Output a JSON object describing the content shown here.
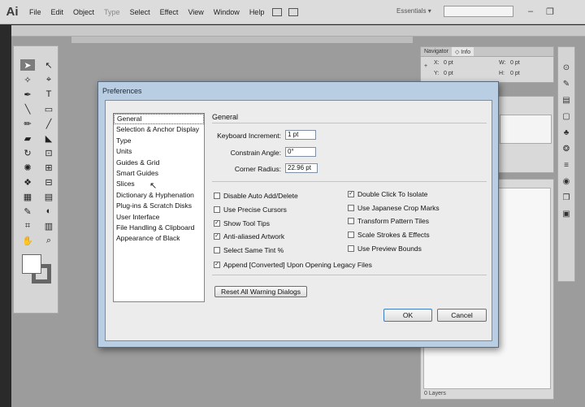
{
  "app": {
    "logo": "Ai",
    "menu": [
      "File",
      "Edit",
      "Object",
      "Type",
      "Select",
      "Effect",
      "View",
      "Window",
      "Help"
    ],
    "workspace": "Essentials",
    "workspace_chevron": "▾"
  },
  "window_controls": {
    "minimize": "–",
    "restore": "❐"
  },
  "tools": {
    "icons": [
      "➤",
      "↖",
      "✧",
      "⌖",
      "✒",
      "T",
      "╲",
      "▭",
      "✏",
      "╱",
      "▰",
      "◣",
      "↻",
      "⊡",
      "✺",
      "⊞",
      "❖",
      "⊟",
      "▦",
      "▤",
      "✎",
      "◐",
      "⌗",
      "▥",
      "✋",
      "⌕"
    ]
  },
  "navigator_panel": {
    "tabs": [
      "Navigator",
      "◇ Info"
    ],
    "x": "0 pt",
    "y": "0 pt",
    "w": "0 pt",
    "h": "0 pt",
    "x_label": "X:",
    "y_label": "Y:",
    "w_label": "W:",
    "h_label": "H:"
  },
  "layers_panel": {
    "count": "0 Layers"
  },
  "dock": {
    "icons": [
      "⊙",
      "✎",
      "▤",
      "▢",
      "♣",
      "❂",
      "≡",
      "◉",
      "❒",
      "▣"
    ]
  },
  "dialog": {
    "title": "Preferences",
    "categories": [
      "General",
      "Selection & Anchor Display",
      "Type",
      "Units",
      "Guides & Grid",
      "Smart Guides",
      "Slices",
      "Dictionary & Hyphenation",
      "Plug-ins & Scratch Disks",
      "User Interface",
      "File Handling & Clipboard",
      "Appearance of Black"
    ],
    "selected_category": "General",
    "section_title": "General",
    "fields": {
      "keyboard_increment": {
        "label": "Keyboard Increment:",
        "value": "1 pt"
      },
      "constrain_angle": {
        "label": "Constrain Angle:",
        "value": "0°"
      },
      "corner_radius": {
        "label": "Corner Radius:",
        "value": "22.96 pt"
      }
    },
    "checkboxes_left": [
      {
        "label": "Disable Auto Add/Delete",
        "checked": false
      },
      {
        "label": "Use Precise Cursors",
        "checked": false
      },
      {
        "label": "Show Tool Tips",
        "checked": true
      },
      {
        "label": "Anti-aliased Artwork",
        "checked": true
      },
      {
        "label": "Select Same Tint %",
        "checked": false
      }
    ],
    "checkboxes_right": [
      {
        "label": "Double Click To Isolate",
        "checked": true
      },
      {
        "label": "Use Japanese Crop Marks",
        "checked": false
      },
      {
        "label": "Transform Pattern Tiles",
        "checked": false
      },
      {
        "label": "Scale Strokes & Effects",
        "checked": false
      },
      {
        "label": "Use Preview Bounds",
        "checked": false
      }
    ],
    "append_converted": {
      "label": "Append [Converted] Upon Opening Legacy Files",
      "checked": true
    },
    "reset_button": "Reset All Warning Dialogs",
    "ok_button": "OK",
    "cancel_button": "Cancel"
  }
}
